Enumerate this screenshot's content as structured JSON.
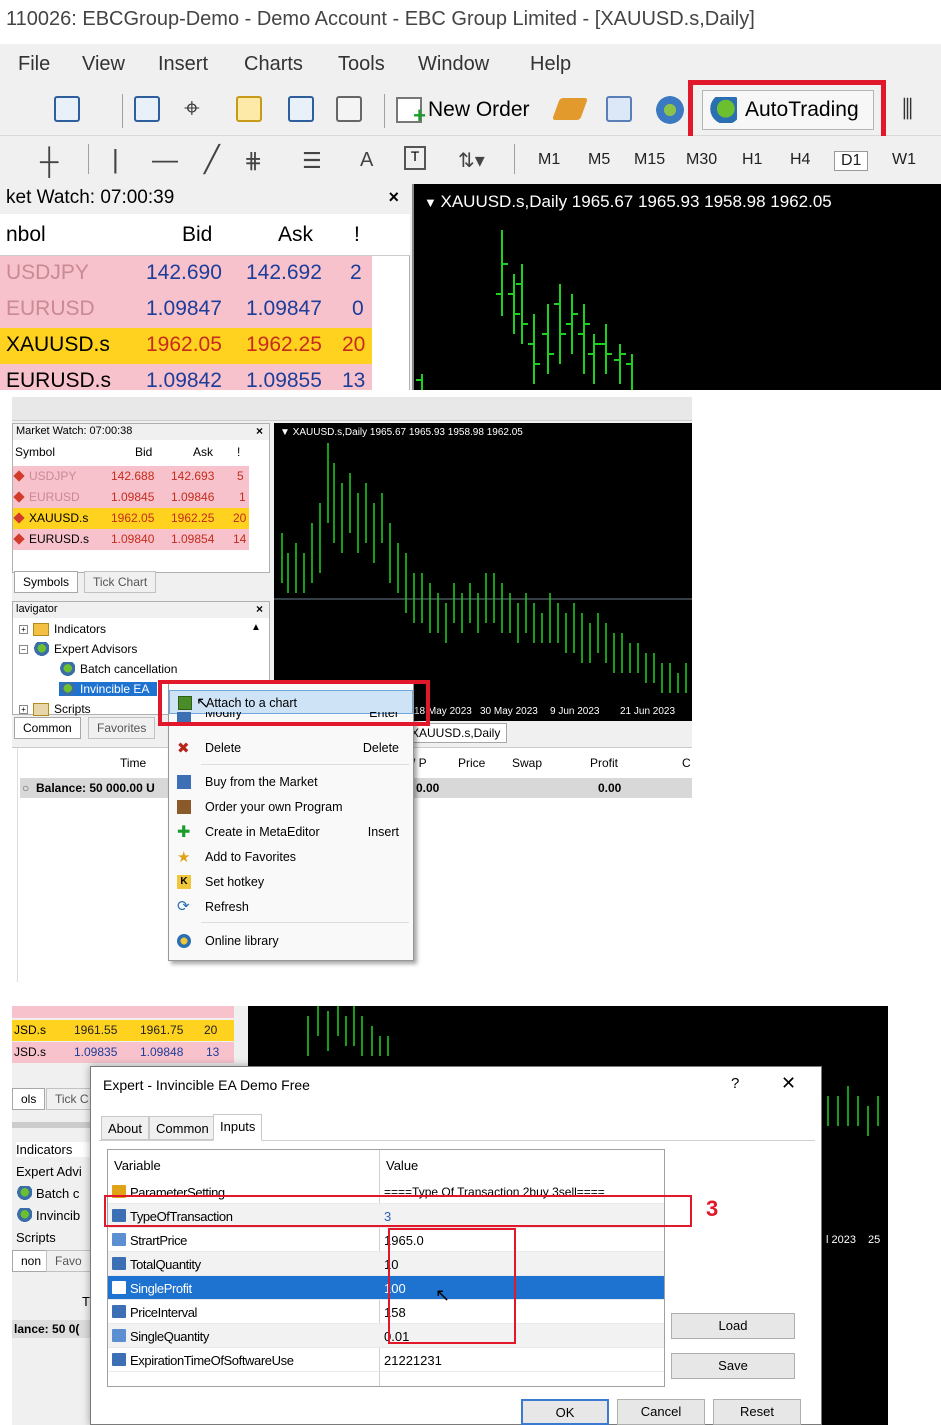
{
  "p1": {
    "window_title": "110026: EBCGroup-Demo - Demo Account - EBC Group Limited - [XAUUSD.s,Daily]",
    "menu": [
      "File",
      "View",
      "Insert",
      "Charts",
      "Tools",
      "Window",
      "Help"
    ],
    "new_order_label": "New Order",
    "autotrading_label": "AutoTrading",
    "timeframes": [
      "M1",
      "M5",
      "M15",
      "M30",
      "H1",
      "H4",
      "D1",
      "W1"
    ],
    "text_tool": "A",
    "market_watch_title": "ket Watch: 07:00:39",
    "close_glyph": "×",
    "cols": [
      "nbol",
      "Bid",
      "Ask",
      "!"
    ],
    "rows": [
      {
        "symbol": "USDJPY",
        "bid": "142.690",
        "ask": "142.692",
        "spread": "2"
      },
      {
        "symbol": "EURUSD",
        "bid": "1.09847",
        "ask": "1.09847",
        "spread": "0"
      },
      {
        "symbol": "XAUUSD.s",
        "bid": "1962.05",
        "ask": "1962.25",
        "spread": "20"
      },
      {
        "symbol": "EURUSD.s",
        "bid": "1.09842",
        "ask": "1.09855",
        "spread": "13"
      }
    ],
    "chart_label": "XAUUSD.s,Daily  1965.67 1965.93 1958.98 1962.05",
    "colors": {
      "highlight": "#e1172b",
      "pink_row": "#f7c2cc",
      "yellow_row": "#ffd21f",
      "candle": "#1fd11f"
    }
  },
  "p2": {
    "market_watch_title": "Market Watch: 07:00:38",
    "close_glyph": "×",
    "cols": [
      "Symbol",
      "Bid",
      "Ask",
      "!"
    ],
    "rows": [
      {
        "symbol": "USDJPY",
        "bid": "142.688",
        "ask": "142.693",
        "spread": "5"
      },
      {
        "symbol": "EURUSD",
        "bid": "1.09845",
        "ask": "1.09846",
        "spread": "1"
      },
      {
        "symbol": "XAUUSD.s",
        "bid": "1962.05",
        "ask": "1962.25",
        "spread": "20"
      },
      {
        "symbol": "EURUSD.s",
        "bid": "1.09840",
        "ask": "1.09854",
        "spread": "14"
      }
    ],
    "tabs_top": [
      "Symbols",
      "Tick Chart"
    ],
    "navigator_title": "lavigator",
    "nav_items": [
      "Indicators",
      "Expert Advisors",
      "Batch cancellation",
      "Invincible EA",
      "Scripts"
    ],
    "tabs_bottom": [
      "Common",
      "Favorites"
    ],
    "chart_label": "XAUUSD.s,Daily  1965.67 1965.93 1958.98 1962.05",
    "chart_dates": [
      "18 May 2023",
      "30 May 2023",
      "9 Jun 2023",
      "21 Jun 2023"
    ],
    "chart_tab": "XAUUSD.s,Daily",
    "terminal_cols": [
      "Time",
      "/ P",
      "Price",
      "Swap",
      "Profit",
      "C"
    ],
    "balance_label": "Balance: 50 000.00 U",
    "balance_tp": "0.00",
    "balance_profit": "0.00",
    "context_menu": [
      {
        "label": "Attach to a chart",
        "shortcut": "",
        "icon": "attach-icon"
      },
      {
        "label": "Modify",
        "shortcut": "Enter",
        "icon": "modify-icon"
      },
      {
        "label": "Delete",
        "shortcut": "Delete",
        "icon": "delete-icon"
      },
      {
        "label": "Buy from the Market",
        "shortcut": "",
        "icon": "market-icon"
      },
      {
        "label": "Order your own Program",
        "shortcut": "",
        "icon": "order-icon"
      },
      {
        "label": "Create in MetaEditor",
        "shortcut": "Insert",
        "icon": "create-icon"
      },
      {
        "label": "Add to Favorites",
        "shortcut": "",
        "icon": "star-icon"
      },
      {
        "label": "Set hotkey",
        "shortcut": "",
        "icon": "hotkey-icon"
      },
      {
        "label": "Refresh",
        "shortcut": "",
        "icon": "refresh-icon"
      },
      {
        "label": "Online library",
        "shortcut": "",
        "icon": "globe-icon"
      }
    ]
  },
  "p3": {
    "bg_rows": [
      {
        "symbol": "JSD.s",
        "bid": "1961.55",
        "ask": "1961.75",
        "spread": "20"
      },
      {
        "symbol": "JSD.s",
        "bid": "1.09835",
        "ask": "1.09848",
        "spread": "13"
      }
    ],
    "bg_tabs": [
      "ols",
      "Tick C"
    ],
    "bg_nav": [
      "Indicators",
      "Expert Advi",
      "Batch c",
      "Invincib",
      "Scripts"
    ],
    "bg_bottom_tabs": [
      "non",
      "Favo"
    ],
    "bg_term_t": "T",
    "bg_balance": "lance: 50 0(",
    "bg_dates": [
      "l 2023",
      "25"
    ],
    "dialog_title": "Expert - Invincible EA Demo Free",
    "help_glyph": "?",
    "close_glyph": "✕",
    "tabs": [
      "About",
      "Common",
      "Inputs"
    ],
    "grid_header": [
      "Variable",
      "Value"
    ],
    "params": [
      {
        "name": "ParameterSetting",
        "value": "====Type Of Transaction 2buy 3sell====",
        "type": "ab"
      },
      {
        "name": "TypeOfTransaction",
        "value": "3",
        "type": "123"
      },
      {
        "name": "StrartPrice",
        "value": "1965.0",
        "type": "ve"
      },
      {
        "name": "TotalQuantity",
        "value": "10",
        "type": "123"
      },
      {
        "name": "SingleProfit",
        "value": "100",
        "type": "123"
      },
      {
        "name": "PriceInterval",
        "value": "158",
        "type": "123"
      },
      {
        "name": "SingleQuantity",
        "value": "0.01",
        "type": "ve"
      },
      {
        "name": "ExpirationTimeOfSoftwareUse",
        "value": "21221231",
        "type": "123"
      }
    ],
    "annotation_number": "3",
    "buttons": {
      "load": "Load",
      "save": "Save",
      "ok": "OK",
      "cancel": "Cancel",
      "reset": "Reset"
    }
  }
}
